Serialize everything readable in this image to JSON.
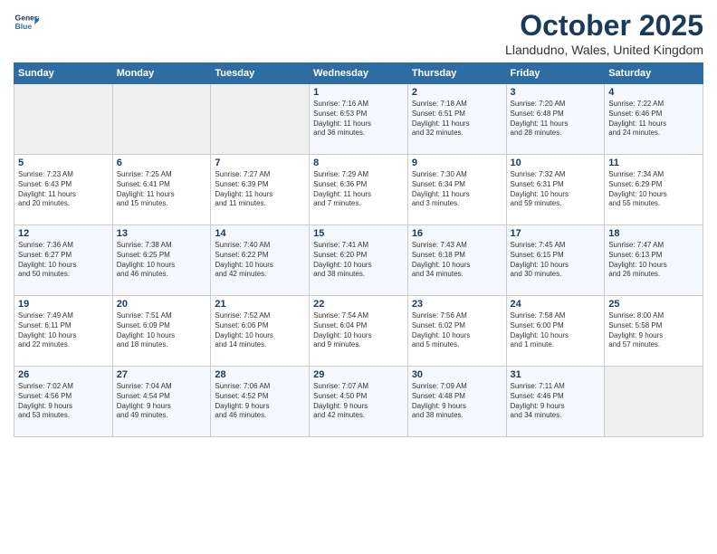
{
  "header": {
    "logo_line1": "General",
    "logo_line2": "Blue",
    "month": "October 2025",
    "location": "Llandudno, Wales, United Kingdom"
  },
  "weekdays": [
    "Sunday",
    "Monday",
    "Tuesday",
    "Wednesday",
    "Thursday",
    "Friday",
    "Saturday"
  ],
  "weeks": [
    [
      {
        "day": "",
        "info": ""
      },
      {
        "day": "",
        "info": ""
      },
      {
        "day": "",
        "info": ""
      },
      {
        "day": "1",
        "info": "Sunrise: 7:16 AM\nSunset: 6:53 PM\nDaylight: 11 hours\nand 36 minutes."
      },
      {
        "day": "2",
        "info": "Sunrise: 7:18 AM\nSunset: 6:51 PM\nDaylight: 11 hours\nand 32 minutes."
      },
      {
        "day": "3",
        "info": "Sunrise: 7:20 AM\nSunset: 6:48 PM\nDaylight: 11 hours\nand 28 minutes."
      },
      {
        "day": "4",
        "info": "Sunrise: 7:22 AM\nSunset: 6:46 PM\nDaylight: 11 hours\nand 24 minutes."
      }
    ],
    [
      {
        "day": "5",
        "info": "Sunrise: 7:23 AM\nSunset: 6:43 PM\nDaylight: 11 hours\nand 20 minutes."
      },
      {
        "day": "6",
        "info": "Sunrise: 7:25 AM\nSunset: 6:41 PM\nDaylight: 11 hours\nand 15 minutes."
      },
      {
        "day": "7",
        "info": "Sunrise: 7:27 AM\nSunset: 6:39 PM\nDaylight: 11 hours\nand 11 minutes."
      },
      {
        "day": "8",
        "info": "Sunrise: 7:29 AM\nSunset: 6:36 PM\nDaylight: 11 hours\nand 7 minutes."
      },
      {
        "day": "9",
        "info": "Sunrise: 7:30 AM\nSunset: 6:34 PM\nDaylight: 11 hours\nand 3 minutes."
      },
      {
        "day": "10",
        "info": "Sunrise: 7:32 AM\nSunset: 6:31 PM\nDaylight: 10 hours\nand 59 minutes."
      },
      {
        "day": "11",
        "info": "Sunrise: 7:34 AM\nSunset: 6:29 PM\nDaylight: 10 hours\nand 55 minutes."
      }
    ],
    [
      {
        "day": "12",
        "info": "Sunrise: 7:36 AM\nSunset: 6:27 PM\nDaylight: 10 hours\nand 50 minutes."
      },
      {
        "day": "13",
        "info": "Sunrise: 7:38 AM\nSunset: 6:25 PM\nDaylight: 10 hours\nand 46 minutes."
      },
      {
        "day": "14",
        "info": "Sunrise: 7:40 AM\nSunset: 6:22 PM\nDaylight: 10 hours\nand 42 minutes."
      },
      {
        "day": "15",
        "info": "Sunrise: 7:41 AM\nSunset: 6:20 PM\nDaylight: 10 hours\nand 38 minutes."
      },
      {
        "day": "16",
        "info": "Sunrise: 7:43 AM\nSunset: 6:18 PM\nDaylight: 10 hours\nand 34 minutes."
      },
      {
        "day": "17",
        "info": "Sunrise: 7:45 AM\nSunset: 6:15 PM\nDaylight: 10 hours\nand 30 minutes."
      },
      {
        "day": "18",
        "info": "Sunrise: 7:47 AM\nSunset: 6:13 PM\nDaylight: 10 hours\nand 26 minutes."
      }
    ],
    [
      {
        "day": "19",
        "info": "Sunrise: 7:49 AM\nSunset: 6:11 PM\nDaylight: 10 hours\nand 22 minutes."
      },
      {
        "day": "20",
        "info": "Sunrise: 7:51 AM\nSunset: 6:09 PM\nDaylight: 10 hours\nand 18 minutes."
      },
      {
        "day": "21",
        "info": "Sunrise: 7:52 AM\nSunset: 6:06 PM\nDaylight: 10 hours\nand 14 minutes."
      },
      {
        "day": "22",
        "info": "Sunrise: 7:54 AM\nSunset: 6:04 PM\nDaylight: 10 hours\nand 9 minutes."
      },
      {
        "day": "23",
        "info": "Sunrise: 7:56 AM\nSunset: 6:02 PM\nDaylight: 10 hours\nand 5 minutes."
      },
      {
        "day": "24",
        "info": "Sunrise: 7:58 AM\nSunset: 6:00 PM\nDaylight: 10 hours\nand 1 minute."
      },
      {
        "day": "25",
        "info": "Sunrise: 8:00 AM\nSunset: 5:58 PM\nDaylight: 9 hours\nand 57 minutes."
      }
    ],
    [
      {
        "day": "26",
        "info": "Sunrise: 7:02 AM\nSunset: 4:56 PM\nDaylight: 9 hours\nand 53 minutes."
      },
      {
        "day": "27",
        "info": "Sunrise: 7:04 AM\nSunset: 4:54 PM\nDaylight: 9 hours\nand 49 minutes."
      },
      {
        "day": "28",
        "info": "Sunrise: 7:06 AM\nSunset: 4:52 PM\nDaylight: 9 hours\nand 46 minutes."
      },
      {
        "day": "29",
        "info": "Sunrise: 7:07 AM\nSunset: 4:50 PM\nDaylight: 9 hours\nand 42 minutes."
      },
      {
        "day": "30",
        "info": "Sunrise: 7:09 AM\nSunset: 4:48 PM\nDaylight: 9 hours\nand 38 minutes."
      },
      {
        "day": "31",
        "info": "Sunrise: 7:11 AM\nSunset: 4:46 PM\nDaylight: 9 hours\nand 34 minutes."
      },
      {
        "day": "",
        "info": ""
      }
    ]
  ]
}
